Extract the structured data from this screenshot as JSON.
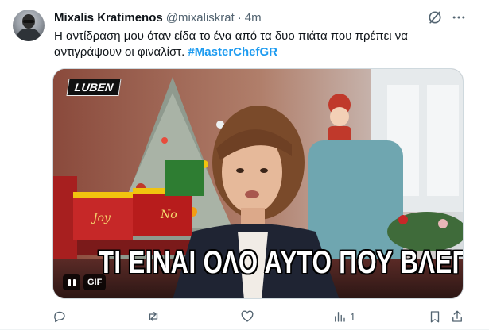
{
  "tweet": {
    "author_name": "Mixalis Kratimenos",
    "handle": "@mixaliskrat",
    "separator": "·",
    "time": "4m",
    "text": "Η αντίδραση μου όταν είδα το ένα από τα δυο πιάτα που πρέπει να αντιγράψουν οι φιναλίστ.",
    "hashtag": "#MasterChefGR"
  },
  "media": {
    "channel_logo": "LUBEN",
    "caption": "ΤΙ ΕΙΝΑΙ ΟΛΟ ΑΥΤΟ ΠΟΥ ΒΛΕΠΩ;",
    "gif_badge": "GIF",
    "gif_toy_word_1": "Joy",
    "gif_toy_word_2": "No"
  },
  "actions": {
    "views_count": "1"
  },
  "icons": {
    "header": [
      "grok-icon",
      "more-icon"
    ],
    "actions": [
      "reply-icon",
      "retweet-icon",
      "like-icon",
      "views-icon",
      "bookmark-icon",
      "share-icon"
    ]
  },
  "colors": {
    "accent": "#1d9bf0",
    "secondary_text": "#536471",
    "primary_text": "#0f1419"
  }
}
